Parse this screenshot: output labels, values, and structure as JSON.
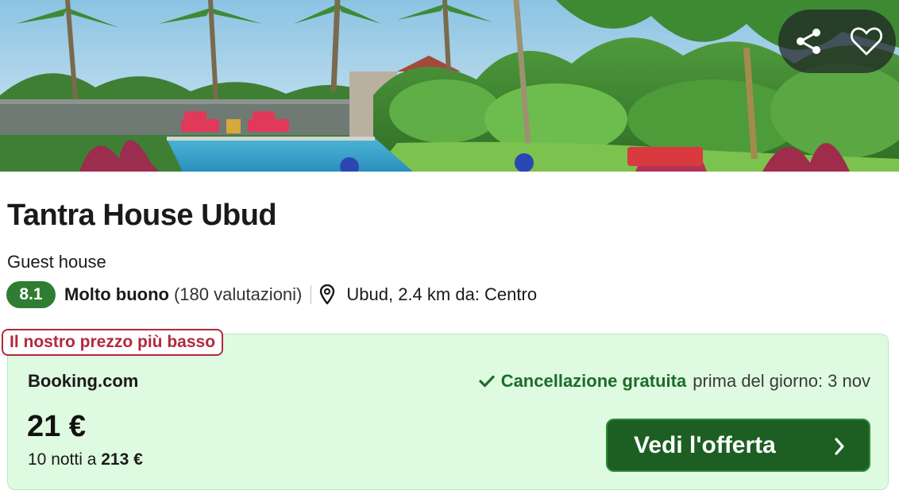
{
  "hotel": {
    "name": "Tantra House Ubud",
    "type": "Guest house",
    "score": "8.1",
    "rating_label": "Molto buono",
    "rating_count": "(180 valutazioni)",
    "location": "Ubud, 2.4 km da: Centro"
  },
  "photo": {
    "description_icon": "pool-garden-photo",
    "actions": [
      "share-icon",
      "heart-icon"
    ]
  },
  "offer": {
    "badge": "Il nostro prezzo più basso",
    "provider": "Booking.com",
    "cancellation_strong": "Cancellazione gratuita",
    "cancellation_rest": "prima del giorno: 3 nov",
    "price": "21 €",
    "total_prefix": "10 notti a",
    "total_amount": "213 €",
    "cta_label": "Vedi l'offerta"
  },
  "colors": {
    "score_badge": "#2e7d32",
    "offer_background": "#defae0",
    "badge_red": "#b3283f",
    "cta_green": "#1d5e22",
    "cancellation_green": "#1e6b2b"
  }
}
